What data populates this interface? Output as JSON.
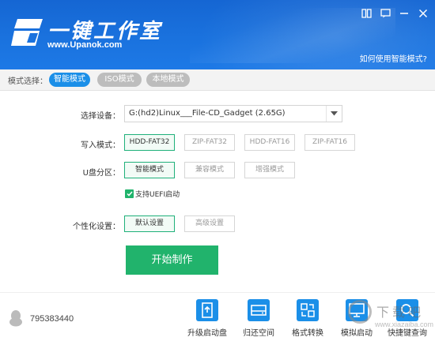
{
  "header": {
    "title": "一键工作室",
    "url": "www.Upanok.com",
    "help_link": "如何使用智能模式?"
  },
  "mode_bar": {
    "label": "模式选择：",
    "modes": [
      {
        "label": "智能模式",
        "active": true
      },
      {
        "label": "ISO模式",
        "active": false
      },
      {
        "label": "本地模式",
        "active": false
      }
    ]
  },
  "form": {
    "device_label": "选择设备：",
    "device_value": "G:(hd2)Linux___File-CD_Gadget (2.65G)",
    "write_label": "写入模式：",
    "write_options": [
      "HDD-FAT32",
      "ZIP-FAT32",
      "HDD-FAT16",
      "ZIP-FAT16"
    ],
    "write_selected": "HDD-FAT32",
    "partition_label": "U盘分区：",
    "partition_options": [
      "智能模式",
      "兼容模式",
      "增强模式"
    ],
    "partition_selected": "智能模式",
    "uefi_label": "支持UEFI启动",
    "uefi_checked": true,
    "personal_label": "个性化设置：",
    "personal_options": [
      "默认设置",
      "高级设置"
    ],
    "personal_selected": "默认设置",
    "start_button": "开始制作"
  },
  "footer": {
    "qq_number": "795383440",
    "tools": [
      "升级启动盘",
      "归还空间",
      "格式转换",
      "模拟启动",
      "快捷键查询"
    ],
    "watermark_text": "下载吧",
    "watermark_url": "www.xiazaiba.com"
  },
  "colors": {
    "header_blue": "#1a72de",
    "accent_blue": "#1b8fe8",
    "accent_green": "#21b36c"
  }
}
